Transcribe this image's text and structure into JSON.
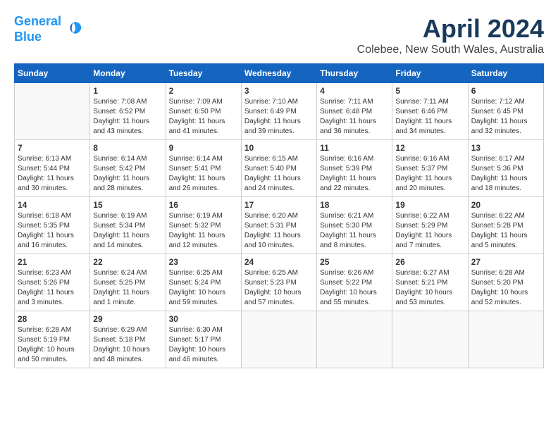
{
  "logo": {
    "line1": "General",
    "line2": "Blue"
  },
  "title": "April 2024",
  "location": "Colebee, New South Wales, Australia",
  "weekdays": [
    "Sunday",
    "Monday",
    "Tuesday",
    "Wednesday",
    "Thursday",
    "Friday",
    "Saturday"
  ],
  "weeks": [
    [
      {
        "day": "",
        "info": ""
      },
      {
        "day": "1",
        "info": "Sunrise: 7:08 AM\nSunset: 6:52 PM\nDaylight: 11 hours\nand 43 minutes."
      },
      {
        "day": "2",
        "info": "Sunrise: 7:09 AM\nSunset: 6:50 PM\nDaylight: 11 hours\nand 41 minutes."
      },
      {
        "day": "3",
        "info": "Sunrise: 7:10 AM\nSunset: 6:49 PM\nDaylight: 11 hours\nand 39 minutes."
      },
      {
        "day": "4",
        "info": "Sunrise: 7:11 AM\nSunset: 6:48 PM\nDaylight: 11 hours\nand 36 minutes."
      },
      {
        "day": "5",
        "info": "Sunrise: 7:11 AM\nSunset: 6:46 PM\nDaylight: 11 hours\nand 34 minutes."
      },
      {
        "day": "6",
        "info": "Sunrise: 7:12 AM\nSunset: 6:45 PM\nDaylight: 11 hours\nand 32 minutes."
      }
    ],
    [
      {
        "day": "7",
        "info": "Sunrise: 6:13 AM\nSunset: 5:44 PM\nDaylight: 11 hours\nand 30 minutes."
      },
      {
        "day": "8",
        "info": "Sunrise: 6:14 AM\nSunset: 5:42 PM\nDaylight: 11 hours\nand 28 minutes."
      },
      {
        "day": "9",
        "info": "Sunrise: 6:14 AM\nSunset: 5:41 PM\nDaylight: 11 hours\nand 26 minutes."
      },
      {
        "day": "10",
        "info": "Sunrise: 6:15 AM\nSunset: 5:40 PM\nDaylight: 11 hours\nand 24 minutes."
      },
      {
        "day": "11",
        "info": "Sunrise: 6:16 AM\nSunset: 5:39 PM\nDaylight: 11 hours\nand 22 minutes."
      },
      {
        "day": "12",
        "info": "Sunrise: 6:16 AM\nSunset: 5:37 PM\nDaylight: 11 hours\nand 20 minutes."
      },
      {
        "day": "13",
        "info": "Sunrise: 6:17 AM\nSunset: 5:36 PM\nDaylight: 11 hours\nand 18 minutes."
      }
    ],
    [
      {
        "day": "14",
        "info": "Sunrise: 6:18 AM\nSunset: 5:35 PM\nDaylight: 11 hours\nand 16 minutes."
      },
      {
        "day": "15",
        "info": "Sunrise: 6:19 AM\nSunset: 5:34 PM\nDaylight: 11 hours\nand 14 minutes."
      },
      {
        "day": "16",
        "info": "Sunrise: 6:19 AM\nSunset: 5:32 PM\nDaylight: 11 hours\nand 12 minutes."
      },
      {
        "day": "17",
        "info": "Sunrise: 6:20 AM\nSunset: 5:31 PM\nDaylight: 11 hours\nand 10 minutes."
      },
      {
        "day": "18",
        "info": "Sunrise: 6:21 AM\nSunset: 5:30 PM\nDaylight: 11 hours\nand 8 minutes."
      },
      {
        "day": "19",
        "info": "Sunrise: 6:22 AM\nSunset: 5:29 PM\nDaylight: 11 hours\nand 7 minutes."
      },
      {
        "day": "20",
        "info": "Sunrise: 6:22 AM\nSunset: 5:28 PM\nDaylight: 11 hours\nand 5 minutes."
      }
    ],
    [
      {
        "day": "21",
        "info": "Sunrise: 6:23 AM\nSunset: 5:26 PM\nDaylight: 11 hours\nand 3 minutes."
      },
      {
        "day": "22",
        "info": "Sunrise: 6:24 AM\nSunset: 5:25 PM\nDaylight: 11 hours\nand 1 minute."
      },
      {
        "day": "23",
        "info": "Sunrise: 6:25 AM\nSunset: 5:24 PM\nDaylight: 10 hours\nand 59 minutes."
      },
      {
        "day": "24",
        "info": "Sunrise: 6:25 AM\nSunset: 5:23 PM\nDaylight: 10 hours\nand 57 minutes."
      },
      {
        "day": "25",
        "info": "Sunrise: 6:26 AM\nSunset: 5:22 PM\nDaylight: 10 hours\nand 55 minutes."
      },
      {
        "day": "26",
        "info": "Sunrise: 6:27 AM\nSunset: 5:21 PM\nDaylight: 10 hours\nand 53 minutes."
      },
      {
        "day": "27",
        "info": "Sunrise: 6:28 AM\nSunset: 5:20 PM\nDaylight: 10 hours\nand 52 minutes."
      }
    ],
    [
      {
        "day": "28",
        "info": "Sunrise: 6:28 AM\nSunset: 5:19 PM\nDaylight: 10 hours\nand 50 minutes."
      },
      {
        "day": "29",
        "info": "Sunrise: 6:29 AM\nSunset: 5:18 PM\nDaylight: 10 hours\nand 48 minutes."
      },
      {
        "day": "30",
        "info": "Sunrise: 6:30 AM\nSunset: 5:17 PM\nDaylight: 10 hours\nand 46 minutes."
      },
      {
        "day": "",
        "info": ""
      },
      {
        "day": "",
        "info": ""
      },
      {
        "day": "",
        "info": ""
      },
      {
        "day": "",
        "info": ""
      }
    ]
  ]
}
